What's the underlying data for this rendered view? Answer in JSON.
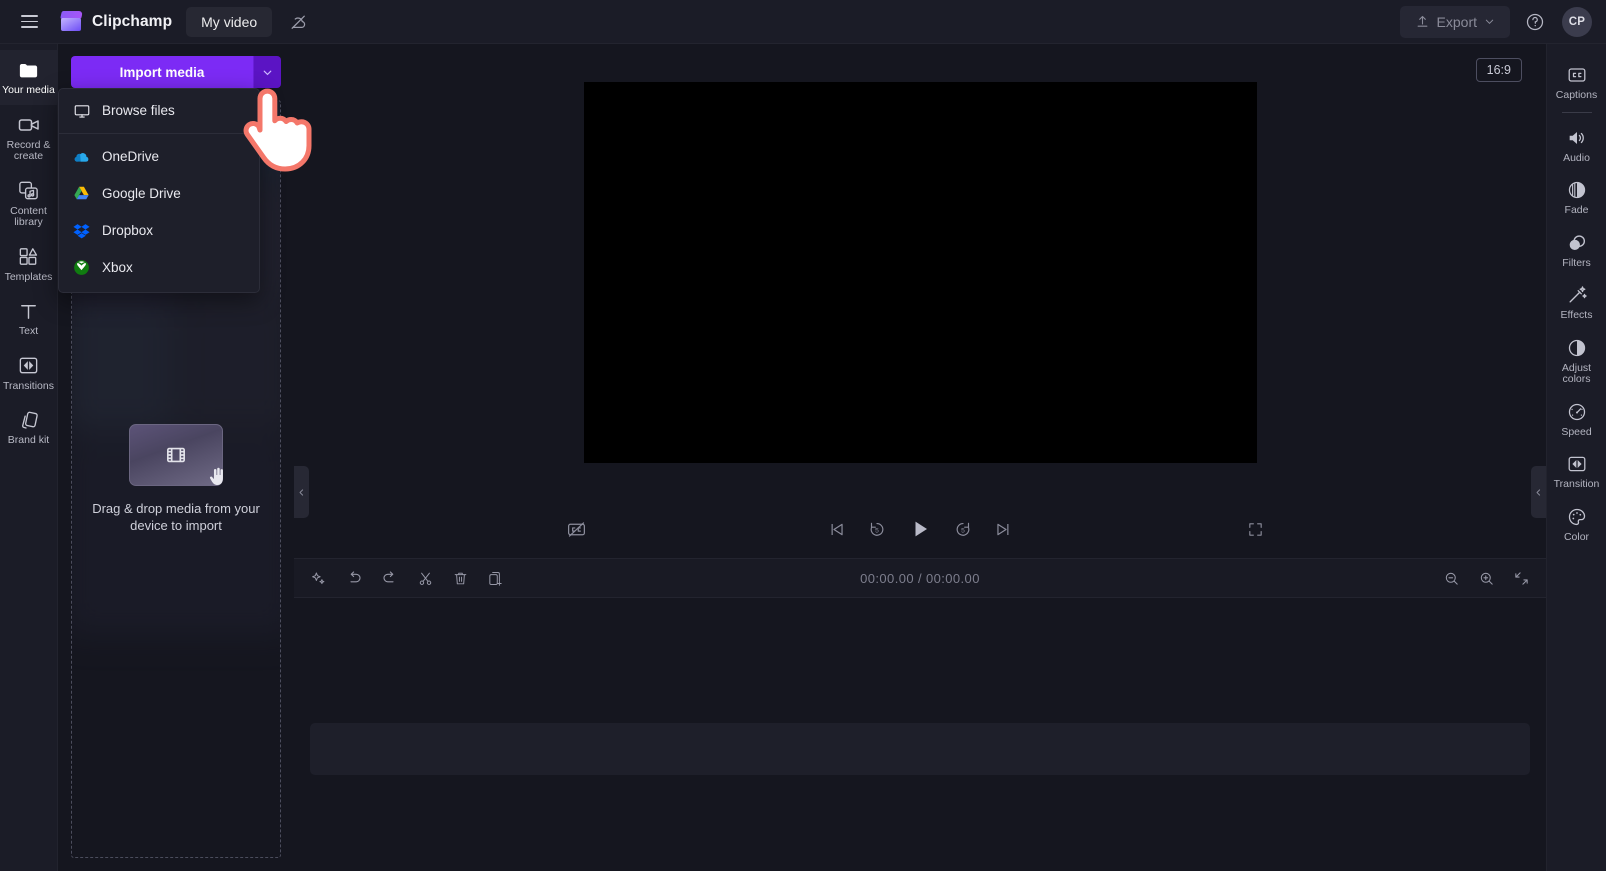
{
  "app": {
    "brand": "Clipchamp",
    "project_name": "My video"
  },
  "topbar": {
    "menu_icon": "hamburger-icon",
    "cloud_icon": "cloud-off-icon",
    "export_label": "Export",
    "export_icon": "upload-icon",
    "help_icon": "help-circle-icon",
    "avatar_initials": "CP"
  },
  "left_rail": {
    "items": [
      {
        "label": "Your media",
        "icon": "folder-icon",
        "active": true
      },
      {
        "label": "Record & create",
        "icon": "camera-video-icon",
        "active": false
      },
      {
        "label": "Content library",
        "icon": "content-library-icon",
        "active": false
      },
      {
        "label": "Templates",
        "icon": "templates-grid-icon",
        "active": false
      },
      {
        "label": "Text",
        "icon": "text-t-icon",
        "active": false
      },
      {
        "label": "Transitions",
        "icon": "transitions-icon",
        "active": false
      },
      {
        "label": "Brand kit",
        "icon": "brand-kit-icon",
        "active": false
      }
    ]
  },
  "media_panel": {
    "import_label": "Import media",
    "caret_icon": "chevron-down-icon",
    "menu": {
      "open": true,
      "groups": [
        [
          {
            "label": "Browse files",
            "icon": "monitor-icon"
          }
        ],
        [
          {
            "label": "OneDrive",
            "icon": "onedrive-icon"
          },
          {
            "label": "Google Drive",
            "icon": "google-drive-icon"
          },
          {
            "label": "Dropbox",
            "icon": "dropbox-icon"
          },
          {
            "label": "Xbox",
            "icon": "xbox-icon"
          }
        ]
      ]
    },
    "dropzone": {
      "text": "Drag & drop media from your device to import",
      "thumb_icon": "film-strip-icon",
      "hand_icon": "drag-hand-icon"
    }
  },
  "stage": {
    "aspect_ratio": "16:9",
    "player": {
      "captions_icon": "closed-captions-off-icon",
      "skip_back_icon": "skip-to-start-icon",
      "rewind_icon": "rewind-5s-icon",
      "play_icon": "play-icon",
      "forward_icon": "forward-5s-icon",
      "skip_forward_icon": "skip-to-end-icon",
      "fullscreen_icon": "fullscreen-icon"
    }
  },
  "timeline": {
    "tools": [
      {
        "name": "magic-wand",
        "icon": "sparkle-icon"
      },
      {
        "name": "undo",
        "icon": "undo-icon"
      },
      {
        "name": "redo",
        "icon": "redo-icon"
      },
      {
        "name": "split",
        "icon": "scissors-icon"
      },
      {
        "name": "delete",
        "icon": "trash-icon"
      },
      {
        "name": "duplicate",
        "icon": "duplicate-icon"
      }
    ],
    "current_time": "00:00.00",
    "total_time": "00:00.00",
    "time_separator": "/",
    "zoom_out_icon": "zoom-out-icon",
    "zoom_in_icon": "zoom-in-icon",
    "fit_icon": "fit-to-timeline-icon"
  },
  "right_rail": {
    "items": [
      {
        "label": "Captions",
        "icon": "cc-icon",
        "separator_after": true
      },
      {
        "label": "Audio",
        "icon": "speaker-icon",
        "separator_after": false
      },
      {
        "label": "Fade",
        "icon": "fade-icon",
        "separator_after": false
      },
      {
        "label": "Filters",
        "icon": "filters-circles-icon",
        "separator_after": false
      },
      {
        "label": "Effects",
        "icon": "magic-wand-icon",
        "separator_after": false
      },
      {
        "label": "Adjust colors",
        "icon": "contrast-icon",
        "separator_after": false
      },
      {
        "label": "Speed",
        "icon": "speedometer-icon",
        "separator_after": false
      },
      {
        "label": "Transition",
        "icon": "transition-icon",
        "separator_after": false
      },
      {
        "label": "Color",
        "icon": "palette-icon",
        "separator_after": false
      }
    ]
  },
  "panels": {
    "collapse_left_icon": "chevron-left-icon",
    "collapse_right_icon": "chevron-left-icon"
  },
  "colors": {
    "accent": "#7c2bf5",
    "accent_dark": "#5b14c4",
    "bg": "#15161f",
    "panel": "#1b1c27",
    "cursor_outline": "#f4776a"
  }
}
